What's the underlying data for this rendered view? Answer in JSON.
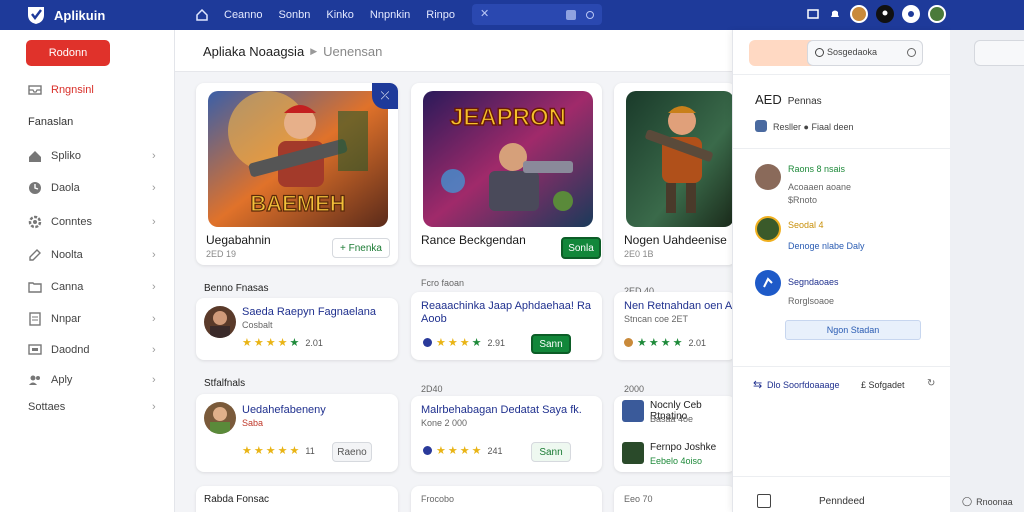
{
  "app": {
    "name": "Aplikuin",
    "nav": [
      "Ceanno",
      "Sonbn",
      "Kinko",
      "Nnpnkin",
      "Rinpo"
    ]
  },
  "sidebar": {
    "create_label": "Rodonn",
    "items": [
      {
        "label": "Rngnsinl",
        "active": true
      },
      {
        "label": "Fanaslan",
        "header": true
      },
      {
        "label": "Spliko",
        "chevron": true
      },
      {
        "label": "Daola",
        "chevron": true
      },
      {
        "label": "Conntes",
        "chevron": true
      },
      {
        "label": "Noolta",
        "chevron": true
      },
      {
        "label": "Canna",
        "chevron": true
      },
      {
        "label": "Nnpar",
        "chevron": true
      },
      {
        "label": "Daodnd",
        "chevron": true
      },
      {
        "label": "Aply",
        "chevron": true
      },
      {
        "label": "Sottaes",
        "chevron": true
      }
    ]
  },
  "breadcrumb": {
    "title": "Apliaka Noaagsia",
    "sub": "Uenensan"
  },
  "games": [
    {
      "title": "Uegabahnin",
      "meta": "2ED 19",
      "button": "+ Fnenka",
      "button_style": "outline",
      "img_text": "BAEMEH"
    },
    {
      "title": "Rance Beckgendan",
      "meta": "",
      "button": "Sonla",
      "button_style": "green",
      "img_text": "JEAPRON"
    },
    {
      "title": "Nogen Uahdeenise",
      "meta": "2E0 1B",
      "button": "",
      "button_style": "",
      "img_text": ""
    }
  ],
  "row1": {
    "col1": {
      "label": "Benno Fnasas",
      "title": "Saeda Raepyn Fagnaelana",
      "sub": "Cosbalt",
      "rating": "2.01"
    },
    "col2": {
      "label": "Fcro faoan",
      "title": "Reaaachinka Jaap Aphdaehaa! Ra Aoob",
      "rating": "2.91",
      "button": "Sann"
    },
    "col3": {
      "label": "2ED 40",
      "title": "Nen Retnahdan oen Al",
      "sub": "Stncan coe 2ET",
      "rating": "2.01"
    }
  },
  "row2": {
    "col1": {
      "label": "Stfalfnals",
      "title": "Uedahefabeneny",
      "sub": "Saba",
      "rating": "11",
      "button": "Raeno"
    },
    "col2": {
      "label": "2D40",
      "title": "Malrbehabagan Dedatat Saya fk.",
      "sub": "Kone 2 000",
      "rating": "241",
      "button": "Sann"
    },
    "col3": {
      "label": "2000",
      "items": [
        {
          "title": "Nocnly Ceb Rtnatino",
          "sub": "Basaa 4oe"
        },
        {
          "title": "Fernpo Joshke",
          "sub": "Eebelo 4oiso"
        }
      ]
    }
  },
  "row3": {
    "col1": {
      "label": "Rabda Fonsac"
    },
    "col2": {
      "label": "Frocobo"
    },
    "col3": {
      "label": "Eeo 70"
    }
  },
  "panel": {
    "search_placeholder": "Sosgedaoka",
    "title_a": "AED",
    "title_b": "Pennas",
    "line1": "Resller ● Fiaal deen",
    "users": [
      {
        "name": "Raons 8 nsais",
        "sub1": "Acoaaen aoane",
        "sub2": "$Rnoto"
      },
      {
        "name": "Seodal 4",
        "sub1": "Denoge nlabe Daly"
      },
      {
        "name": "Segndaoaes",
        "sub1": "Rorglsoaoe"
      }
    ],
    "view_button": "Ngon Stadan",
    "footer_left": "Dlo Soorfdoaaage",
    "footer_right": "£ Sofgadet",
    "bottom_label": "Penndeed"
  },
  "farright": {
    "footer": "Rnoonaa"
  },
  "colors": {
    "topbar": "#1e3a9a",
    "accent_red": "#e0322b",
    "green": "#12873a",
    "link_blue": "#20318f"
  }
}
